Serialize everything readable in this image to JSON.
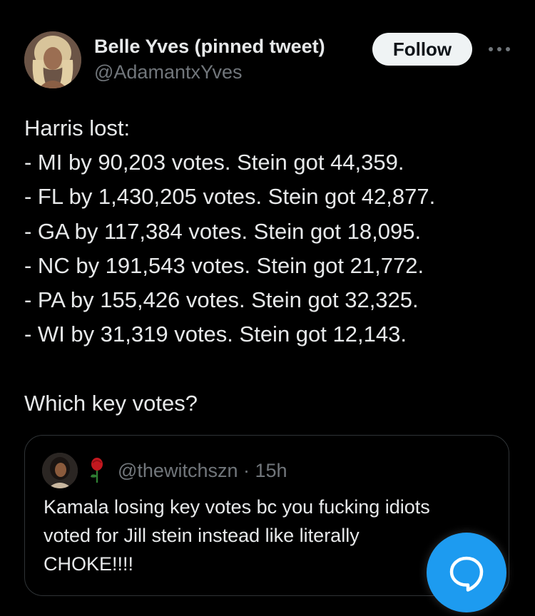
{
  "tweet": {
    "author": {
      "display_name": "Belle Yves (pinned tweet)",
      "handle": "@AdamantxYves",
      "avatar": "profile-photo"
    },
    "follow_label": "Follow",
    "more_icon": "more-dots-icon",
    "text_lines": [
      "Harris lost:",
      "- MI by 90,203 votes. Stein got 44,359.",
      "- FL by 1,430,205 votes. Stein got 42,877.",
      "- GA by 117,384 votes. Stein got 18,095.",
      "- NC by 191,543 votes. Stein got 21,772.",
      "- PA by 155,426 votes. Stein got 32,325.",
      "- WI by 31,319 votes. Stein got 12,143.",
      "",
      "Which key votes?"
    ],
    "quoted": {
      "name_emoji": "🌹",
      "handle": "@thewitchszn",
      "separator": "·",
      "time": "15h",
      "text_lines": [
        "Kamala losing key votes bc you fucking idiots",
        "voted for Jill stein instead like literally",
        "CHOKE!!!!"
      ]
    }
  },
  "compose_fab": {
    "icon": "new-message-bubble-icon"
  },
  "colors": {
    "background": "#000000",
    "primary_text": "#e7e9ea",
    "secondary_text": "#71767b",
    "border": "#2f3336",
    "follow_bg": "#eff3f4",
    "accent": "#1d9bf0"
  }
}
